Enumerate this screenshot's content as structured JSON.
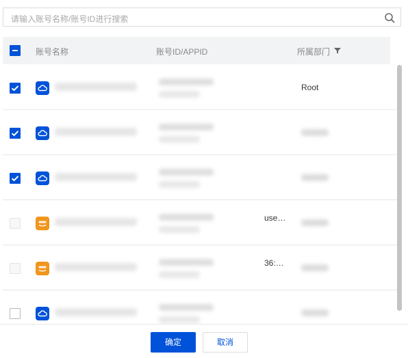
{
  "search": {
    "placeholder": "请输入账号名称/账号ID进行搜索",
    "icon": "search-icon"
  },
  "table": {
    "columns": {
      "name": "账号名称",
      "id": "账号ID/APPID",
      "dept": "所属部门"
    },
    "select_all_state": "indeterminate",
    "rows": [
      {
        "checked": true,
        "provider": "cloud",
        "id_tail": "",
        "dept": "Root"
      },
      {
        "checked": true,
        "provider": "cloud",
        "id_tail": "",
        "dept": ""
      },
      {
        "checked": true,
        "provider": "cloud",
        "id_tail": "",
        "dept": ""
      },
      {
        "checked": false,
        "provider": "aws",
        "id_tail": "use…",
        "dept": "",
        "disabled": true
      },
      {
        "checked": false,
        "provider": "aws",
        "id_tail": "36:…",
        "dept": "",
        "disabled": true
      },
      {
        "checked": false,
        "provider": "cloud",
        "id_tail": "",
        "dept": ""
      }
    ]
  },
  "footer": {
    "confirm_label": "确定",
    "cancel_label": "取消"
  },
  "colors": {
    "accent": "#0052d9",
    "aws": "#f0951e",
    "header_bg": "#f2f3f5"
  }
}
